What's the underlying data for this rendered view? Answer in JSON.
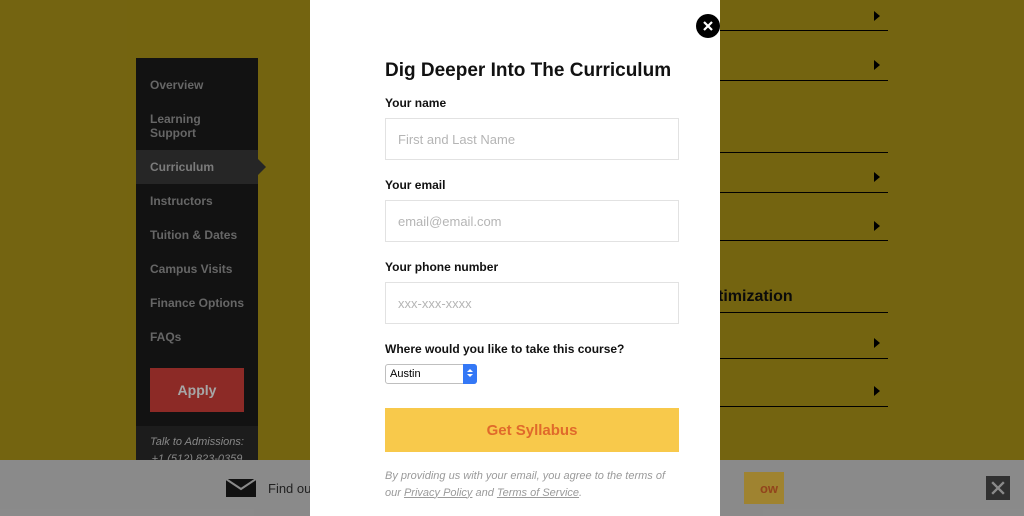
{
  "sidebar": {
    "items": [
      {
        "label": "Overview"
      },
      {
        "label": "Learning Support"
      },
      {
        "label": "Curriculum"
      },
      {
        "label": "Instructors"
      },
      {
        "label": "Tuition & Dates"
      },
      {
        "label": "Campus Visits"
      },
      {
        "label": "Finance Options"
      },
      {
        "label": "FAQs"
      }
    ],
    "active_index": 2,
    "apply_label": "Apply",
    "admissions_label": "Talk to Admissions:",
    "admissions_phone": "+1 (512) 823-0359"
  },
  "right": {
    "section_title_fragment": "timization"
  },
  "banner": {
    "text_fragment_left": "Find out",
    "cta_fragment": "ow"
  },
  "modal": {
    "title": "Dig Deeper Into The Curriculum",
    "name_label": "Your name",
    "name_placeholder": "First and Last Name",
    "email_label": "Your email",
    "email_placeholder": "email@email.com",
    "phone_label": "Your phone number",
    "phone_placeholder": "xxx-xxx-xxxx",
    "location_label": "Where would you like to take this course?",
    "location_selected": "Austin",
    "submit_label": "Get Syllabus",
    "disclaimer_prefix": "By providing us with your email, you agree to the terms of our ",
    "privacy_label": "Privacy Policy",
    "disclaimer_and": " and ",
    "tos_label": "Terms of Service",
    "disclaimer_suffix": "."
  }
}
